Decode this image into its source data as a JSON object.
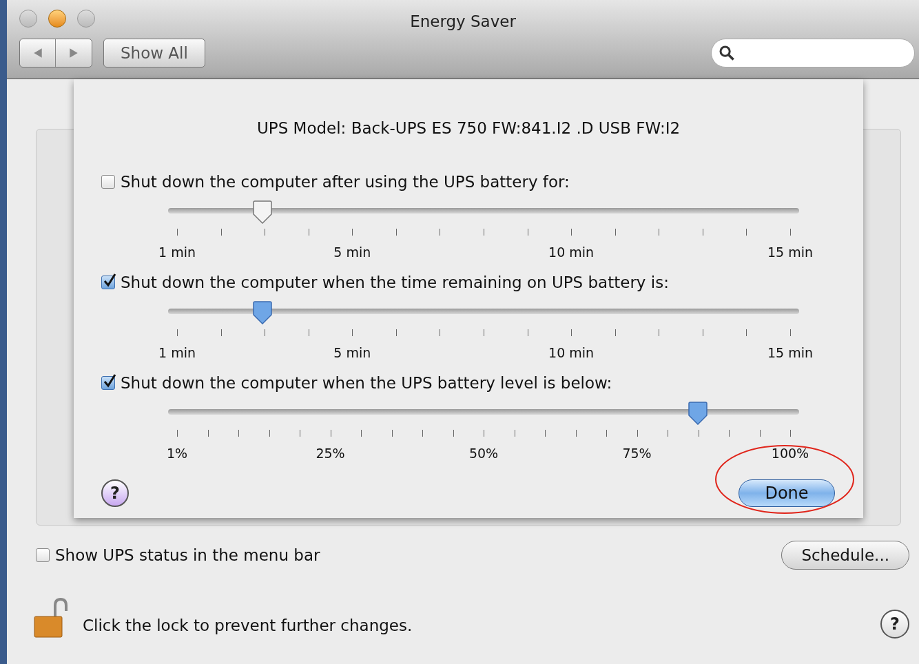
{
  "window": {
    "title": "Energy Saver"
  },
  "toolbar": {
    "show_all": "Show All"
  },
  "sheet": {
    "ups_model": "UPS Model:  Back-UPS ES 750 FW:841.I2 .D USB FW:I2",
    "options": [
      {
        "label": "Shut down the computer after using the UPS battery for:",
        "checked": false,
        "kind": "minutes",
        "level": 0.15,
        "ticks": [
          "1 min",
          "5 min",
          "10 min",
          "15 min"
        ]
      },
      {
        "label": "Shut down the computer when the time remaining on UPS battery is:",
        "checked": true,
        "kind": "minutes",
        "level": 0.15,
        "ticks": [
          "1 min",
          "5 min",
          "10 min",
          "15 min"
        ]
      },
      {
        "label": "Shut down the computer when the UPS battery level is below:",
        "checked": true,
        "kind": "percent",
        "level": 0.84,
        "ticks": [
          "1%",
          "25%",
          "50%",
          "75%",
          "100%"
        ]
      }
    ],
    "help": "?",
    "done": "Done"
  },
  "show_status": {
    "label": "Show UPS status in the menu bar",
    "checked": false
  },
  "schedule": "Schedule...",
  "lock_text": "Click the lock to prevent further changes.",
  "help": "?"
}
